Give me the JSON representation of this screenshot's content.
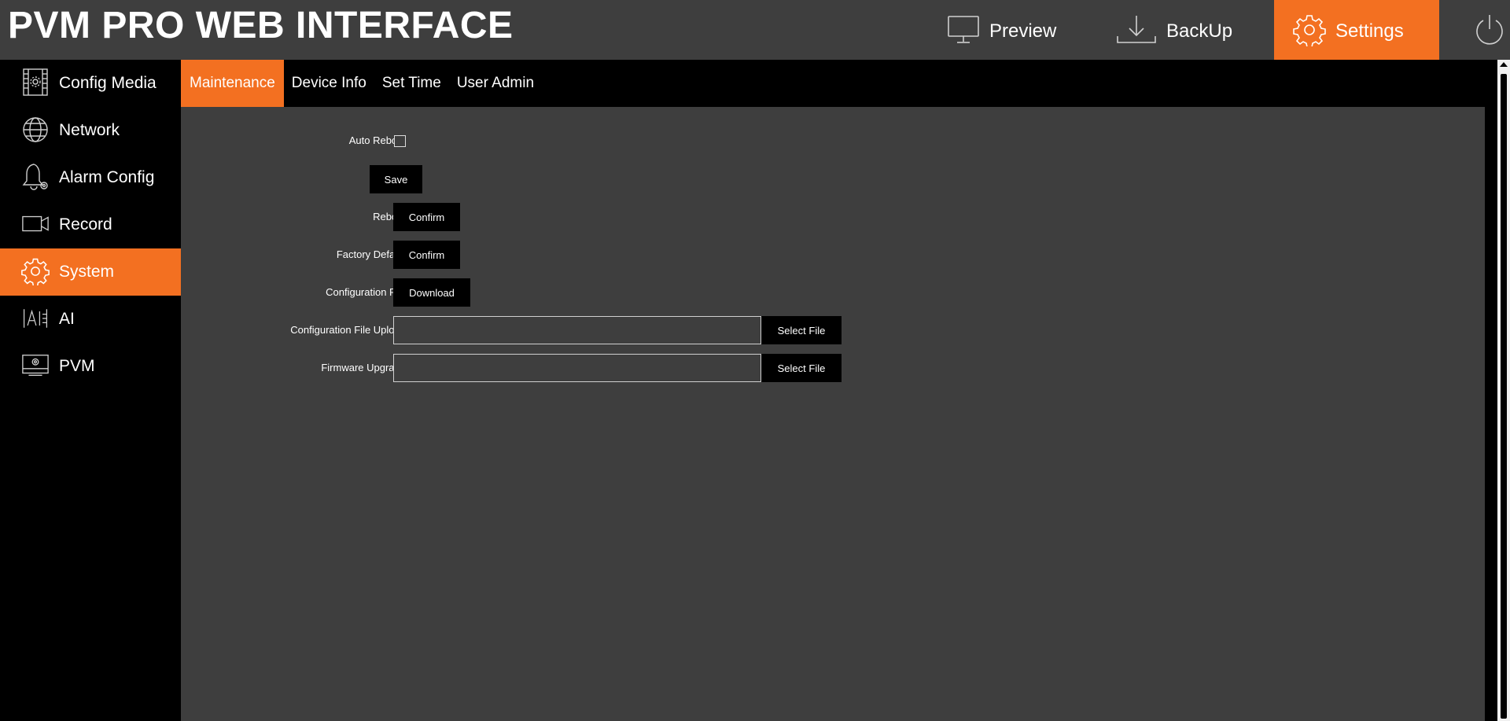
{
  "header": {
    "title": "PVM PRO WEB INTERFACE",
    "nav": [
      {
        "label": "Preview",
        "icon": "monitor-icon"
      },
      {
        "label": "BackUp",
        "icon": "download-icon"
      },
      {
        "label": "Settings",
        "icon": "gear-icon"
      }
    ],
    "power_icon": "power-icon",
    "active": "Settings"
  },
  "sidebar": {
    "items": [
      {
        "label": "Config Media",
        "icon": "film-config-icon"
      },
      {
        "label": "Network",
        "icon": "globe-icon"
      },
      {
        "label": "Alarm Config",
        "icon": "bell-icon"
      },
      {
        "label": "Record",
        "icon": "video-camera-icon"
      },
      {
        "label": "System",
        "icon": "gear-icon"
      },
      {
        "label": "AI",
        "icon": "ai-icon"
      },
      {
        "label": "PVM",
        "icon": "pvm-monitor-icon"
      }
    ],
    "active": "System"
  },
  "tabs": {
    "items": [
      {
        "label": "Maintenance"
      },
      {
        "label": "Device Info"
      },
      {
        "label": "Set Time"
      },
      {
        "label": "User Admin"
      }
    ],
    "active": "Maintenance"
  },
  "maintenance": {
    "auto_reboot_label": "Auto Reboot",
    "auto_reboot_checked": false,
    "save_label": "Save",
    "reboot_label": "Reboot",
    "reboot_button": "Confirm",
    "factory_default_label": "Factory Default",
    "factory_default_button": "Confirm",
    "config_file_label": "Configuration File",
    "config_file_button": "Download",
    "config_upload_label": "Configuration File Upload",
    "config_upload_value": "",
    "config_upload_button": "Select File",
    "firmware_label": "Firmware Upgrade",
    "firmware_value": "",
    "firmware_button": "Select File"
  },
  "colors": {
    "accent": "#f37021",
    "panel": "#3e3e3e",
    "background": "#000000"
  }
}
